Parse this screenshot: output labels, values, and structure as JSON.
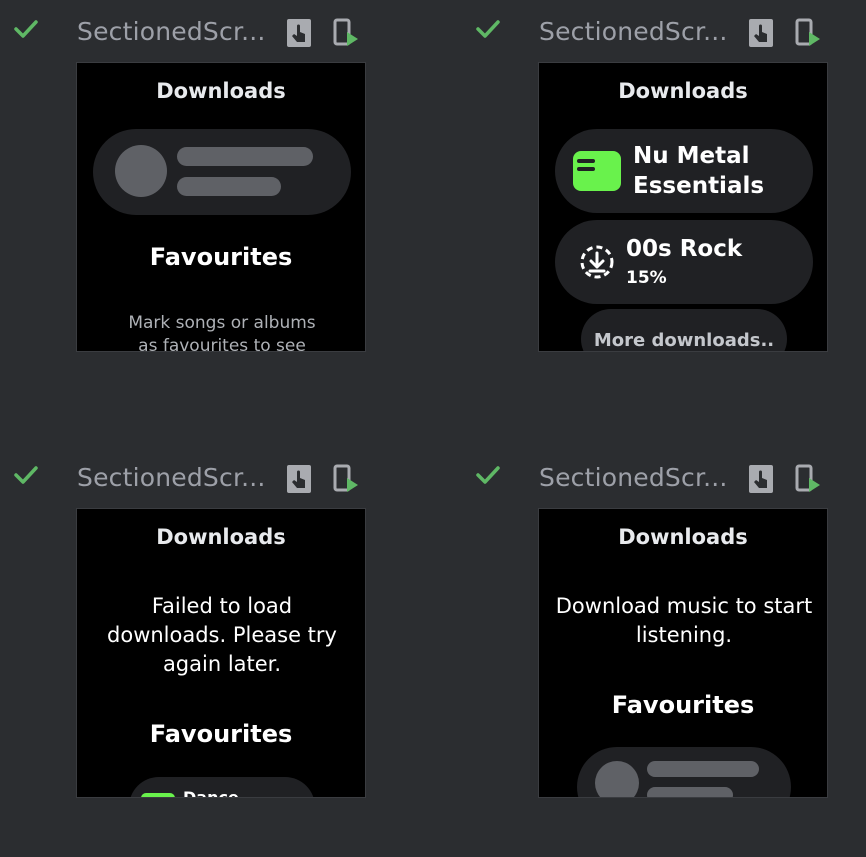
{
  "previews": [
    {
      "name": "SectionedScr...",
      "screen_title": "Downloads",
      "favourites_label": "Favourites",
      "favourites_message": "Mark songs or albums as favourites to see"
    },
    {
      "name": "SectionedScr...",
      "screen_title": "Downloads",
      "downloads": [
        {
          "title_line1": "Nu Metal",
          "title_line2": "Essentials"
        },
        {
          "title": "00s Rock",
          "progress_label": "15%"
        }
      ],
      "more_label": "More downloads.."
    },
    {
      "name": "SectionedScr...",
      "screen_title": "Downloads",
      "error_message": "Failed to load downloads. Please try again later.",
      "favourites_label": "Favourites",
      "partial_item": "Dance"
    },
    {
      "name": "SectionedScr...",
      "screen_title": "Downloads",
      "empty_message": "Download music to start listening.",
      "favourites_label": "Favourites"
    }
  ],
  "colors": {
    "ide_background": "#2b2d30",
    "check": "#5fb865",
    "accent_green": "#69f24c",
    "chip": "#202124",
    "placeholder": "#5f6166"
  },
  "icons": {
    "status": "check-icon",
    "interactive": "interactive-mode-icon",
    "deploy": "run-on-device-icon"
  }
}
